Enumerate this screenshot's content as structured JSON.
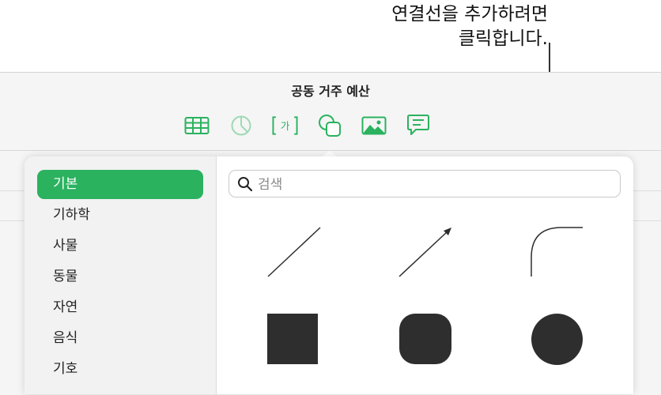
{
  "callout": {
    "line1": "연결선을 추가하려면",
    "line2": "클릭합니다."
  },
  "document": {
    "title": "공동 거주 예산"
  },
  "toolbar": {
    "items": [
      {
        "icon": "table-icon",
        "color": "#2bb25f"
      },
      {
        "icon": "chart-icon",
        "color": "#9fd9b4"
      },
      {
        "icon": "text-box-icon",
        "color": "#2bb25f",
        "glyph": "가"
      },
      {
        "icon": "shape-icon",
        "color": "#2bb25f",
        "selected": true
      },
      {
        "icon": "media-icon",
        "color": "#2bb25f"
      },
      {
        "icon": "comment-icon",
        "color": "#2bb25f"
      }
    ]
  },
  "shapes_panel": {
    "categories": [
      {
        "label": "기본",
        "selected": true
      },
      {
        "label": "기하학"
      },
      {
        "label": "사물"
      },
      {
        "label": "동물"
      },
      {
        "label": "자연"
      },
      {
        "label": "음식"
      },
      {
        "label": "기호"
      }
    ],
    "search": {
      "placeholder": "검색",
      "value": ""
    },
    "shapes": [
      "line",
      "arrow",
      "curved-line",
      "square",
      "rounded-square",
      "circle"
    ],
    "shape_color": "#2e2e2e",
    "accent_color": "#2bb25f"
  }
}
